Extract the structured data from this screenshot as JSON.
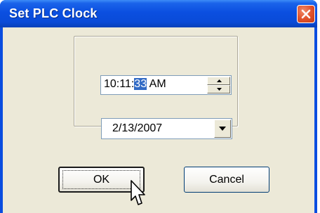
{
  "window": {
    "title": "Set PLC Clock",
    "close_icon": "close-x-icon"
  },
  "time_picker": {
    "prefix": "10:11:",
    "selected": "33",
    "suffix": " AM",
    "spinner_up_icon": "arrow-up-icon",
    "spinner_down_icon": "arrow-down-icon"
  },
  "date_picker": {
    "value": "2/13/2007",
    "dropdown_icon": "chevron-down-icon"
  },
  "buttons": {
    "ok_label": "OK",
    "cancel_label": "Cancel"
  },
  "cursor": {
    "icon": "mouse-pointer-icon"
  },
  "colors": {
    "titlebar": "#0a4de0",
    "client_bg": "#ece9d8",
    "close_button": "#e2532d",
    "selection": "#316ac5"
  }
}
